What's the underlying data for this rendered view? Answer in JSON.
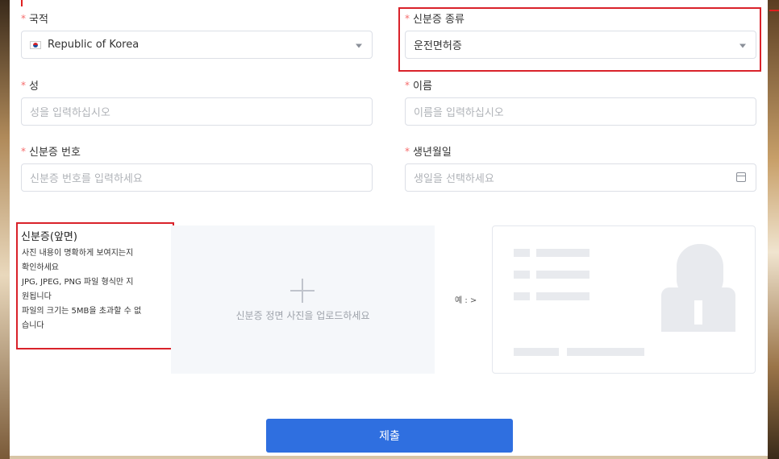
{
  "form": {
    "nationality": {
      "label": "국적",
      "value": "Republic of Korea"
    },
    "id_type": {
      "label": "신분증 종류",
      "value": "운전면허증"
    },
    "surname": {
      "label": "성",
      "placeholder": "성을 입력하십시오"
    },
    "given_name": {
      "label": "이름",
      "placeholder": "이름을 입력하십시오"
    },
    "id_number": {
      "label": "신분증 번호",
      "placeholder": "신분증 번호를 입력하세요"
    },
    "birth_date": {
      "label": "생년월일",
      "placeholder": "생일을 선택하세요"
    },
    "required_mark": "*"
  },
  "id_front": {
    "title": "신분증(앞면)",
    "lines": [
      "사진 내용이 명확하게 보여지는지",
      "확인하세요",
      "JPG, JPEG, PNG 파일 형식만 지",
      "원됩니다",
      "파일의 크기는 5MB을 초과할 수 없",
      "습니다"
    ],
    "upload_text": "신분증 정면 사진을 업로드하세요",
    "example_label": "예 : >"
  },
  "submit_label": "제출",
  "icons": {
    "select_arrow": "chevron-down-icon",
    "calendar": "calendar-icon",
    "upload": "plus-icon",
    "flag": "korea-flag-icon"
  },
  "colors": {
    "primary": "#2f6fe0",
    "required": "#f56c6c",
    "highlight_box": "#d9222a"
  }
}
